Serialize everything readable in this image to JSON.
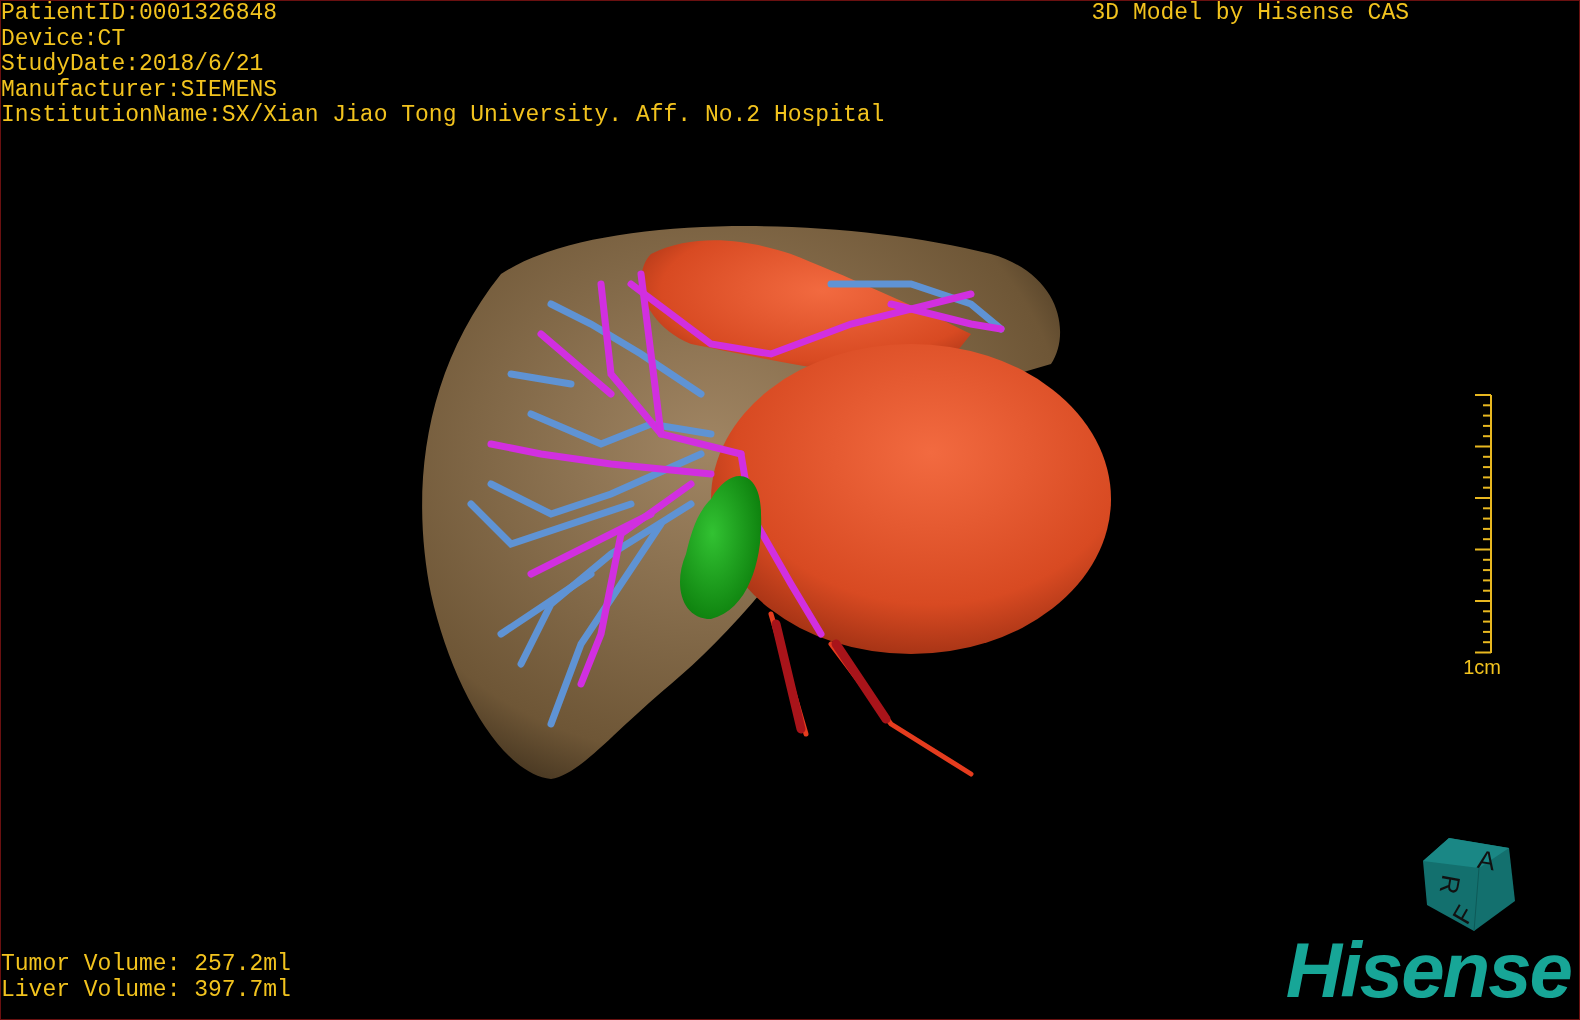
{
  "study_info": [
    "PatientID:0001326848",
    "Device:CT",
    "StudyDate:2018/6/21",
    "Manufacturer:SIEMENS",
    "InstitutionName:SX/Xian Jiao Tong University. Aff. No.2 Hospital"
  ],
  "caption": "3D Model by Hisense CAS",
  "scale_bar": {
    "label": "1cm"
  },
  "volumes": [
    "Tumor Volume: 257.2ml",
    "Liver Volume: 397.7ml"
  ],
  "orientation_cube": {
    "faces": [
      "A",
      "R",
      "F"
    ]
  },
  "logo": "Hisense"
}
